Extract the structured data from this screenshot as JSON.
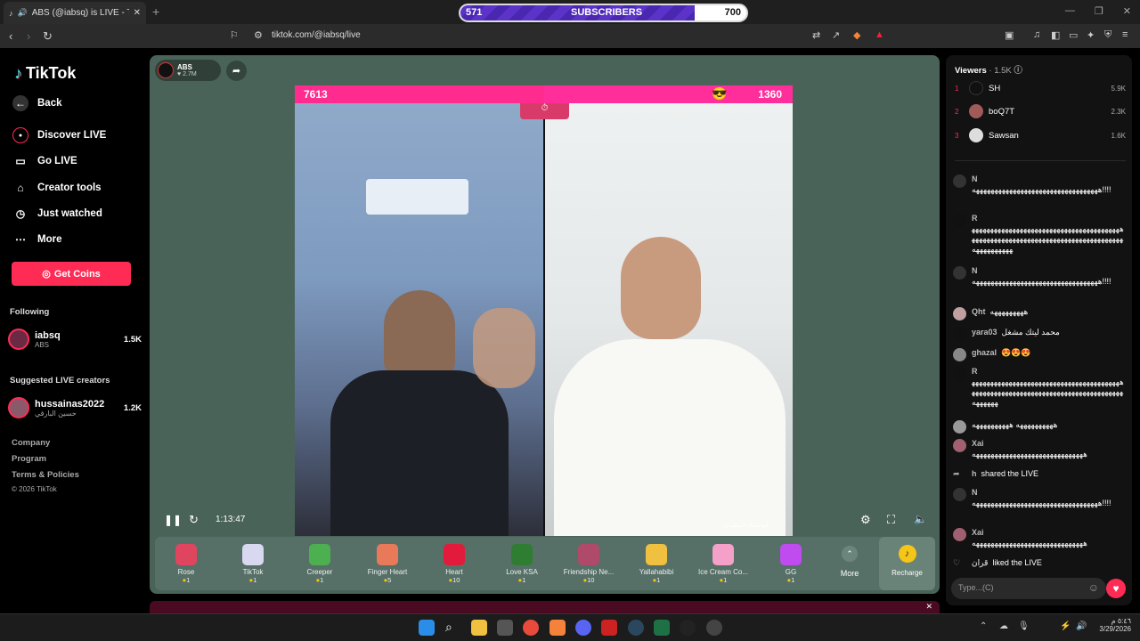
{
  "browser": {
    "tab_title": "ABS (@iabsq) is LIVE - TikTok",
    "url": "tiktok.com/@iabsq/live"
  },
  "overlay_subs": {
    "left": "571",
    "label": "SUBSCRIBERS",
    "right": "700",
    "progress": 0.82
  },
  "sidebar": {
    "logo": "TikTok",
    "nav": [
      {
        "label": "Back",
        "icon": "back-arrow-icon"
      },
      {
        "label": "Discover LIVE",
        "icon": "live-icon"
      },
      {
        "label": "Go LIVE",
        "icon": "camera-icon"
      },
      {
        "label": "Creator tools",
        "icon": "lightbulb-icon"
      },
      {
        "label": "Just watched",
        "icon": "history-icon"
      },
      {
        "label": "More",
        "icon": "more-icon"
      }
    ],
    "get_coins": "Get Coins",
    "following_title": "Following",
    "following": [
      {
        "name": "iabsq",
        "sub": "ABS",
        "count": "1.5K"
      }
    ],
    "suggested_title": "Suggested LIVE creators",
    "suggested": [
      {
        "name": "hussainas2022",
        "sub": "حسين البارقي",
        "count": "1.2K"
      }
    ],
    "footer": [
      "Company",
      "Program",
      "Terms & Policies",
      "© 2026 TikTok"
    ]
  },
  "host": {
    "name": "ABS",
    "likes": "2.7M"
  },
  "battle": {
    "left_score": "7613",
    "right_score": "1360"
  },
  "player": {
    "time": "1:13:47",
    "caption": "ابو مجاد المطيري"
  },
  "gifts": [
    {
      "name": "Rose",
      "price": "1",
      "color": "#e0455f"
    },
    {
      "name": "TikTok",
      "price": "1",
      "color": "#d8d8f0"
    },
    {
      "name": "Creeper",
      "price": "1",
      "color": "#4caf50"
    },
    {
      "name": "Finger Heart",
      "price": "5",
      "color": "#e87a5a"
    },
    {
      "name": "Heart",
      "price": "10",
      "color": "#e21b3c"
    },
    {
      "name": "Love KSA",
      "price": "1",
      "color": "#2e7d32"
    },
    {
      "name": "Friendship Ne...",
      "price": "10",
      "color": "#b04a6a"
    },
    {
      "name": "Yallahabibi",
      "price": "1",
      "color": "#f0c040"
    },
    {
      "name": "Ice Cream Co...",
      "price": "1",
      "color": "#f5a0c8"
    },
    {
      "name": "GG",
      "price": "1",
      "color": "#c04cf0"
    }
  ],
  "more_label": "More",
  "recharge_label": "Recharge",
  "viewers": {
    "title": "Viewers",
    "count": "1.5K",
    "top": [
      {
        "rank": "1",
        "name": "SH",
        "count": "5.9K"
      },
      {
        "rank": "2",
        "name": "boQ7T",
        "count": "2.3K"
      },
      {
        "rank": "3",
        "name": "Sawsan",
        "count": "1.6K"
      }
    ]
  },
  "chat": [
    {
      "user": "N",
      "text": "ههههههههههههههههههههههههههههههههههه!!!!"
    },
    {
      "user": "R",
      "text": "ههههههههههههههههههههههههههههههههههههههههههههههههههههههههههههههههههههههههههههههههههههههههههههه"
    },
    {
      "user": "N",
      "text": "ههههههههههههههههههههههههههههههههههه!!!!"
    },
    {
      "user": "Qht",
      "text": "هههههههههه"
    },
    {
      "user": "yara03",
      "text": "محمد ليتك مشغل"
    },
    {
      "user": "ghazal",
      "text": "😍😍😍"
    },
    {
      "user": "R",
      "text": "ههههههههههههههههههههههههههههههههههههههههههههههههههههههههههههههههههههههههههههههههههههههههه"
    },
    {
      "user": "",
      "text": "ههههههههههه ههههههههههه"
    },
    {
      "user": "Xai",
      "text": "ههههههههههههههههههههههههههههههه"
    },
    {
      "user": "h",
      "text": "shared the LIVE"
    },
    {
      "user": "N",
      "text": "ههههههههههههههههههههههههههههههههههه!!!!"
    },
    {
      "user": "Xai",
      "text": "ههههههههههههههههههههههههههههههه"
    },
    {
      "user": "قران",
      "text": "liked the LIVE"
    }
  ],
  "chat_placeholder": "Type...(C)",
  "clock": {
    "time": "٥:٤٦ م",
    "date": "3/29/2026"
  }
}
